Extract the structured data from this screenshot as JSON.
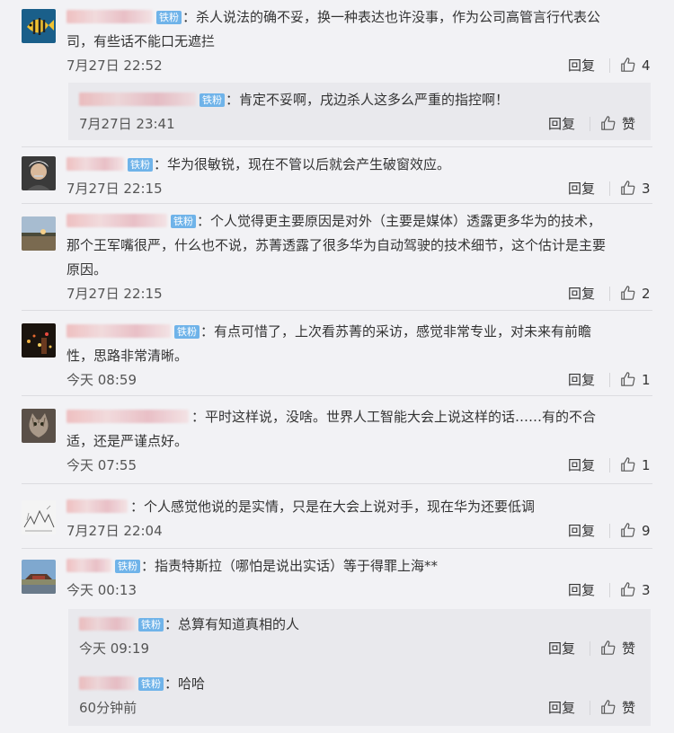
{
  "badge_label": "铁粉",
  "reply_label": "回复",
  "like_zan": "赞",
  "comments": [
    {
      "line1": "：杀人说法的确不妥，换一种表达也许没事，作为公司高管言行代表公",
      "line2": "司，有些话不能口无遮拦",
      "time": "7月27日 22:52",
      "likes": "4"
    },
    {
      "text": "：肯定不妥啊，戌边杀人这多么严重的指控啊！",
      "time": "7月27日 23:41"
    },
    {
      "text": "：华为很敏锐，现在不管以后就会产生破窗效应。",
      "time": "7月27日 22:15",
      "likes": "3"
    },
    {
      "line1": "：个人觉得更主要原因是对外（主要是媒体）透露更多华为的技术，",
      "line2": "那个王军嘴很严，什么也不说，苏菁透露了很多华为自动驾驶的技术细节，这个估计是主要",
      "line3": "原因。",
      "time": "7月27日 22:15",
      "likes": "2"
    },
    {
      "line1": "：有点可惜了，上次看苏菁的采访，感觉非常专业，对未来有前瞻",
      "line2": "性，思路非常清晰。",
      "time": "今天 08:59",
      "likes": "1"
    },
    {
      "line1": "：平时这样说，没啥。世界人工智能大会上说这样的话……有的不合",
      "line2": "适，还是严谨点好。",
      "time": "今天 07:55",
      "likes": "1"
    },
    {
      "text": "：个人感觉他说的是实情，只是在大会上说对手，现在华为还要低调",
      "time": "7月27日 22:04",
      "likes": "9"
    },
    {
      "text": "：指责特斯拉（哪怕是说出实话）等于得罪上海**",
      "time": "今天 00:13",
      "likes": "3"
    },
    {
      "text": "：总算有知道真相的人",
      "time": "今天 09:19"
    },
    {
      "text": "：哈哈",
      "time": "60分钟前"
    }
  ]
}
